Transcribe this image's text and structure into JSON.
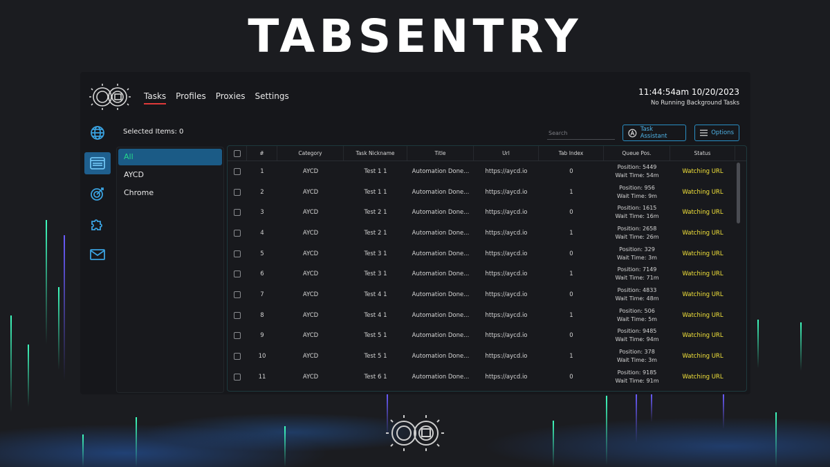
{
  "brand": {
    "title": "TABSENTRY"
  },
  "header": {
    "nav": [
      "Tasks",
      "Profiles",
      "Proxies",
      "Settings"
    ],
    "active_nav": "Tasks",
    "clock": "11:44:54am 10/20/2023",
    "background_status": "No Running Background Tasks"
  },
  "sidebar": {
    "icons": [
      "globe-icon",
      "browser-window-icon",
      "target-icon",
      "puzzle-icon",
      "mail-icon"
    ],
    "active": "browser-window-icon"
  },
  "toolbar": {
    "selected_items": "Selected Items: 0",
    "search_placeholder": "Search",
    "task_assistant_label": "Task Assistant",
    "options_label": "Options"
  },
  "categories": [
    "All",
    "AYCD",
    "Chrome"
  ],
  "table": {
    "columns": [
      "#",
      "Category",
      "Task Nickname",
      "Title",
      "Url",
      "Tab Index",
      "Queue Pos.",
      "Status"
    ],
    "rows": [
      {
        "num": "1",
        "category": "AYCD",
        "nickname": "Test 1 1",
        "title": "Automation Done...",
        "url": "https://aycd.io",
        "tab": "0",
        "pos": "Position: 5449",
        "wait": "Wait Time: 54m",
        "status": "Watching URL"
      },
      {
        "num": "2",
        "category": "AYCD",
        "nickname": "Test 1 1",
        "title": "Automation Done...",
        "url": "https://aycd.io",
        "tab": "1",
        "pos": "Position: 956",
        "wait": "Wait Time: 9m",
        "status": "Watching URL"
      },
      {
        "num": "3",
        "category": "AYCD",
        "nickname": "Test 2 1",
        "title": "Automation Done...",
        "url": "https://aycd.io",
        "tab": "0",
        "pos": "Position: 1615",
        "wait": "Wait Time: 16m",
        "status": "Watching URL"
      },
      {
        "num": "4",
        "category": "AYCD",
        "nickname": "Test 2 1",
        "title": "Automation Done...",
        "url": "https://aycd.io",
        "tab": "1",
        "pos": "Position: 2658",
        "wait": "Wait Time: 26m",
        "status": "Watching URL"
      },
      {
        "num": "5",
        "category": "AYCD",
        "nickname": "Test 3 1",
        "title": "Automation Done...",
        "url": "https://aycd.io",
        "tab": "0",
        "pos": "Position: 329",
        "wait": "Wait Time: 3m",
        "status": "Watching URL"
      },
      {
        "num": "6",
        "category": "AYCD",
        "nickname": "Test 3 1",
        "title": "Automation Done...",
        "url": "https://aycd.io",
        "tab": "1",
        "pos": "Position: 7149",
        "wait": "Wait Time: 71m",
        "status": "Watching URL"
      },
      {
        "num": "7",
        "category": "AYCD",
        "nickname": "Test 4 1",
        "title": "Automation Done...",
        "url": "https://aycd.io",
        "tab": "0",
        "pos": "Position: 4833",
        "wait": "Wait Time: 48m",
        "status": "Watching URL"
      },
      {
        "num": "8",
        "category": "AYCD",
        "nickname": "Test 4 1",
        "title": "Automation Done...",
        "url": "https://aycd.io",
        "tab": "1",
        "pos": "Position: 506",
        "wait": "Wait Time: 5m",
        "status": "Watching URL"
      },
      {
        "num": "9",
        "category": "AYCD",
        "nickname": "Test 5 1",
        "title": "Automation Done...",
        "url": "https://aycd.io",
        "tab": "0",
        "pos": "Position: 9485",
        "wait": "Wait Time: 94m",
        "status": "Watching URL"
      },
      {
        "num": "10",
        "category": "AYCD",
        "nickname": "Test 5 1",
        "title": "Automation Done...",
        "url": "https://aycd.io",
        "tab": "1",
        "pos": "Position: 378",
        "wait": "Wait Time: 3m",
        "status": "Watching URL"
      },
      {
        "num": "11",
        "category": "AYCD",
        "nickname": "Test 6 1",
        "title": "Automation Done...",
        "url": "https://aycd.io",
        "tab": "0",
        "pos": "Position: 9185",
        "wait": "Wait Time: 91m",
        "status": "Watching URL"
      }
    ]
  },
  "colors": {
    "accent": "#2a8fc5",
    "active_nav_underline": "#e03a3a",
    "status_text": "#f3e33a",
    "active_category_text": "#25d88c"
  }
}
